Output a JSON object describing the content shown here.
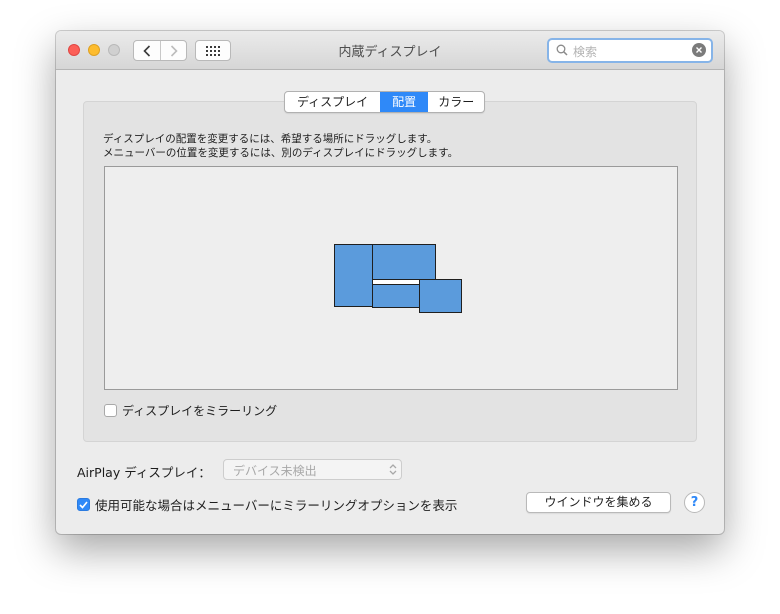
{
  "window": {
    "title": "内蔵ディスプレイ"
  },
  "search": {
    "placeholder": "検索"
  },
  "tabs": [
    {
      "label": "ディスプレイ",
      "active": false
    },
    {
      "label": "配置",
      "active": true
    },
    {
      "label": "カラー",
      "active": false
    }
  ],
  "arrangement": {
    "instructions": [
      "ディスプレイの配置を変更するには、希望する場所にドラッグします。",
      "メニューバーの位置を変更するには、別のディスプレイにドラッグします。"
    ]
  },
  "mirror": {
    "label": "ディスプレイをミラーリング",
    "checked": false
  },
  "airplay": {
    "label": "AirPlay ディスプレイ：",
    "value": "デバイス未検出"
  },
  "show_options": {
    "label": "使用可能な場合はメニューバーにミラーリングオプションを表示",
    "checked": true
  },
  "gather_button": {
    "label": "ウインドウを集める"
  },
  "help_button": {
    "label": "?"
  },
  "colors": {
    "accent": "#2f89f8",
    "display_fill": "#5b9bdc"
  }
}
